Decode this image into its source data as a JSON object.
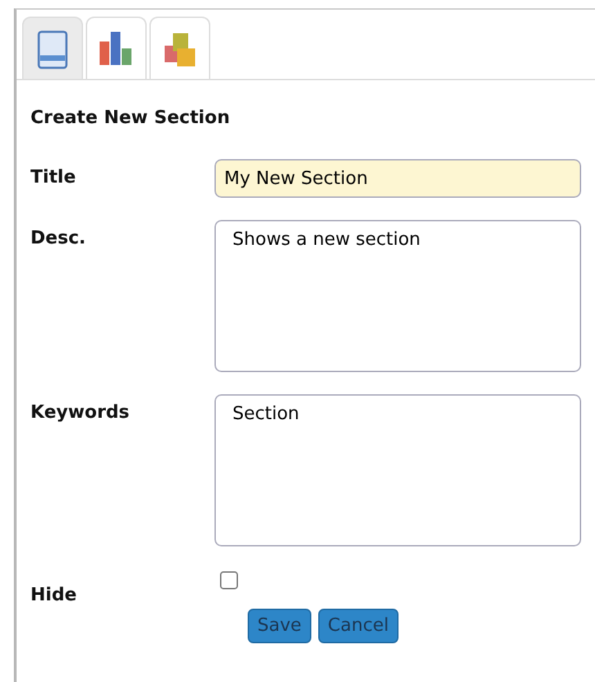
{
  "tabs": [
    {
      "kind": "page",
      "selected": true
    },
    {
      "kind": "chart",
      "selected": false
    },
    {
      "kind": "blocks",
      "selected": false
    }
  ],
  "heading": "Create New Section",
  "fields": [
    {
      "kind": "text",
      "label": "Title",
      "value": "My New Section",
      "focused": true
    },
    {
      "kind": "textarea",
      "label": "Desc.",
      "value": "Shows a new section",
      "focused": false
    },
    {
      "kind": "textarea",
      "label": "Keywords",
      "value": "Section",
      "focused": false
    },
    {
      "kind": "checkbox",
      "label": "Hide",
      "checked": false
    }
  ],
  "buttons": [
    "Save",
    "Cancel"
  ]
}
